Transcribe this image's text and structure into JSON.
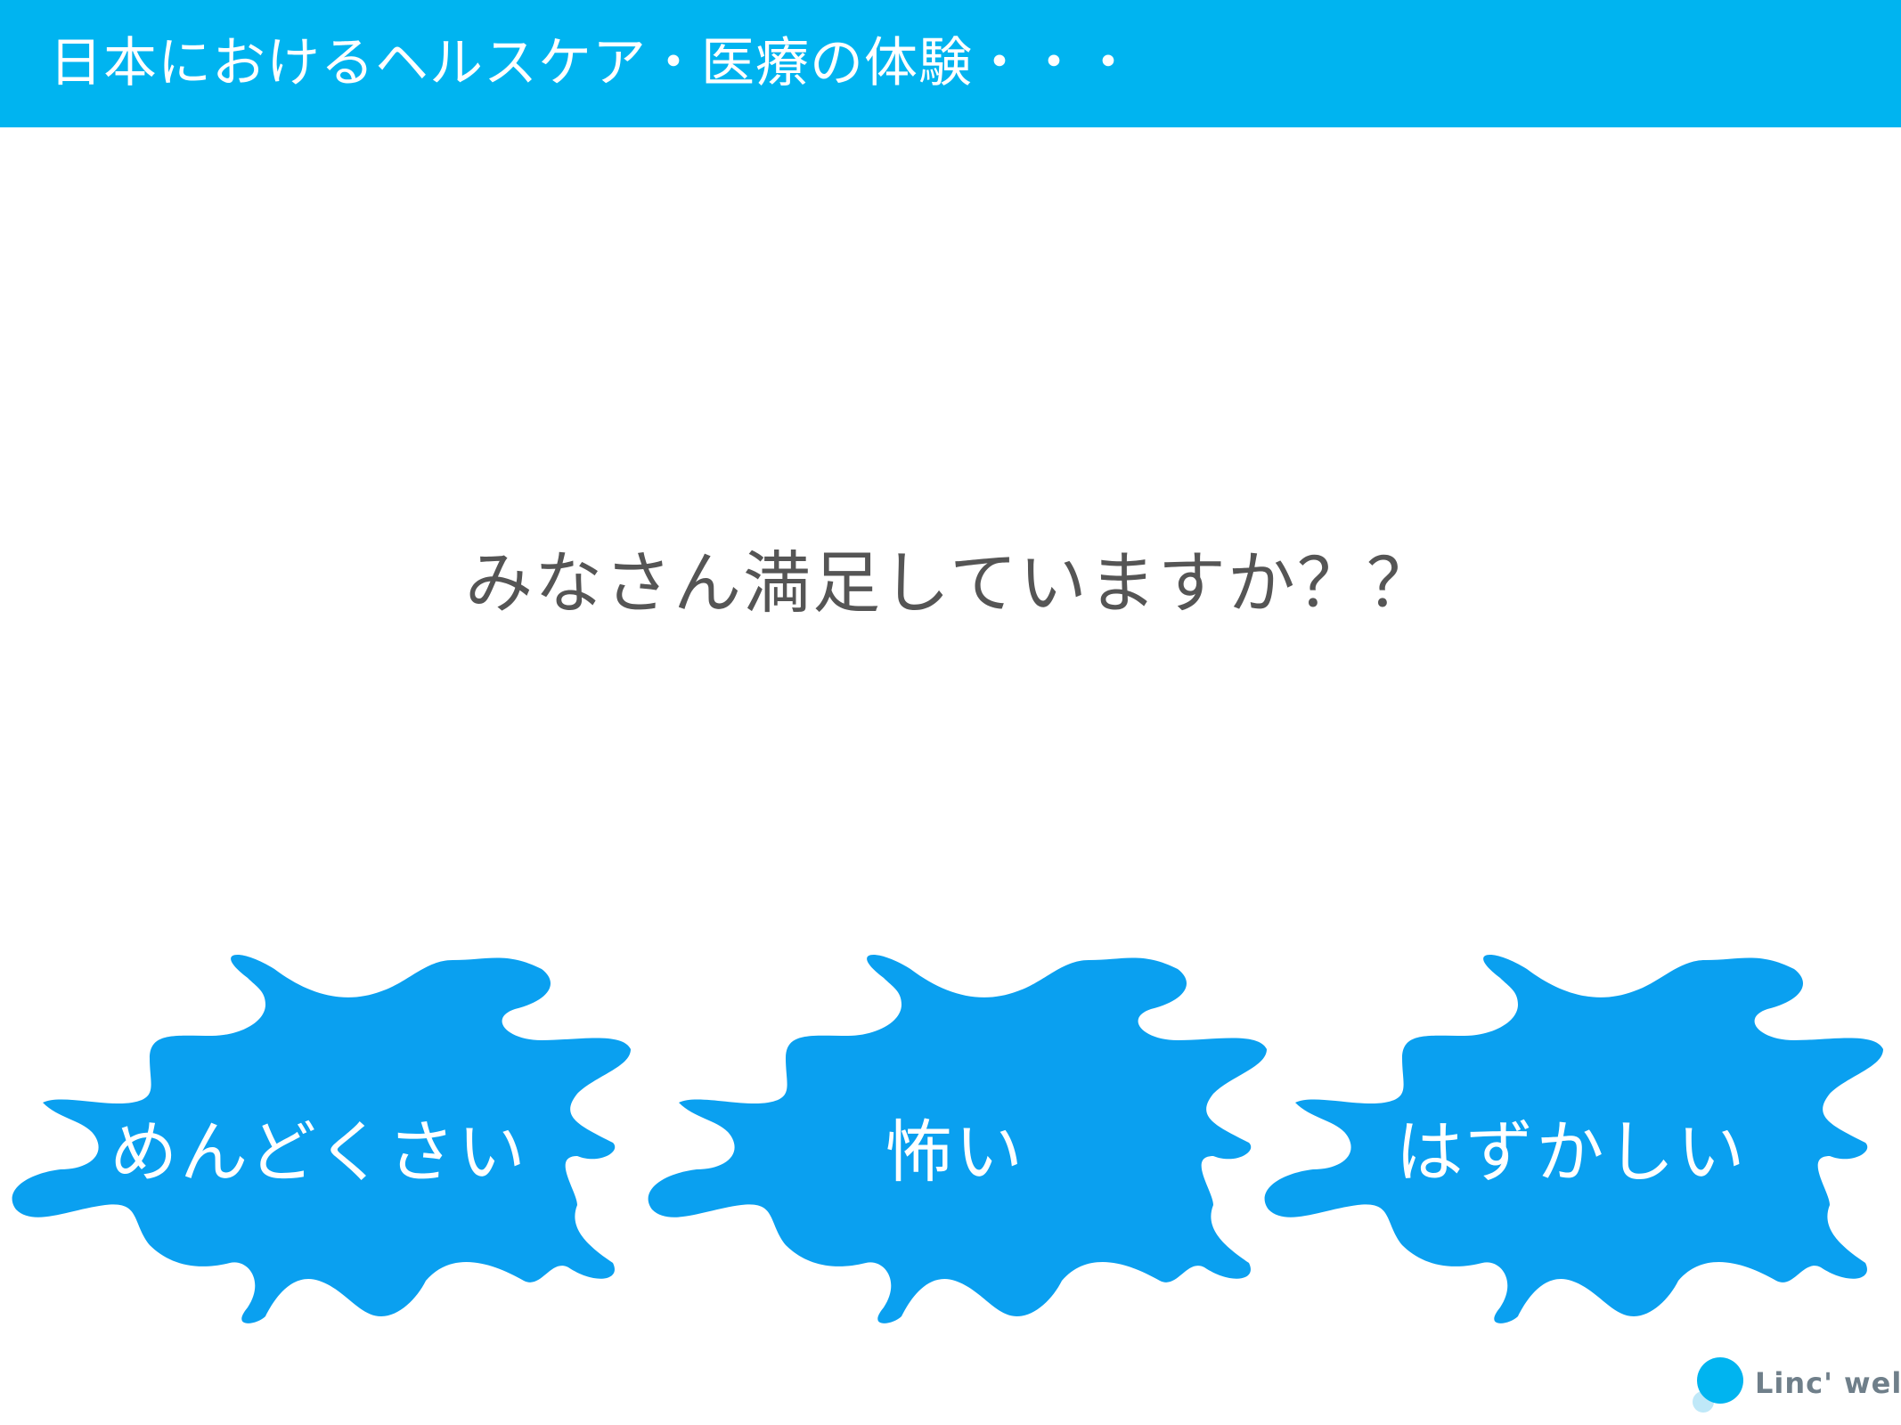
{
  "header": {
    "title": "日本におけるヘルスケア・医療の体験・・・"
  },
  "main": {
    "question": "みなさん満足していますか？？"
  },
  "splats": [
    {
      "label": "めんどくさい"
    },
    {
      "label": "怖い"
    },
    {
      "label": "はずかしい"
    }
  ],
  "logo": {
    "text": "Linc' well"
  },
  "colors": {
    "header_bg": "#00b4f0",
    "splat_fill": "#0aa0f0",
    "question_text": "#555555"
  }
}
